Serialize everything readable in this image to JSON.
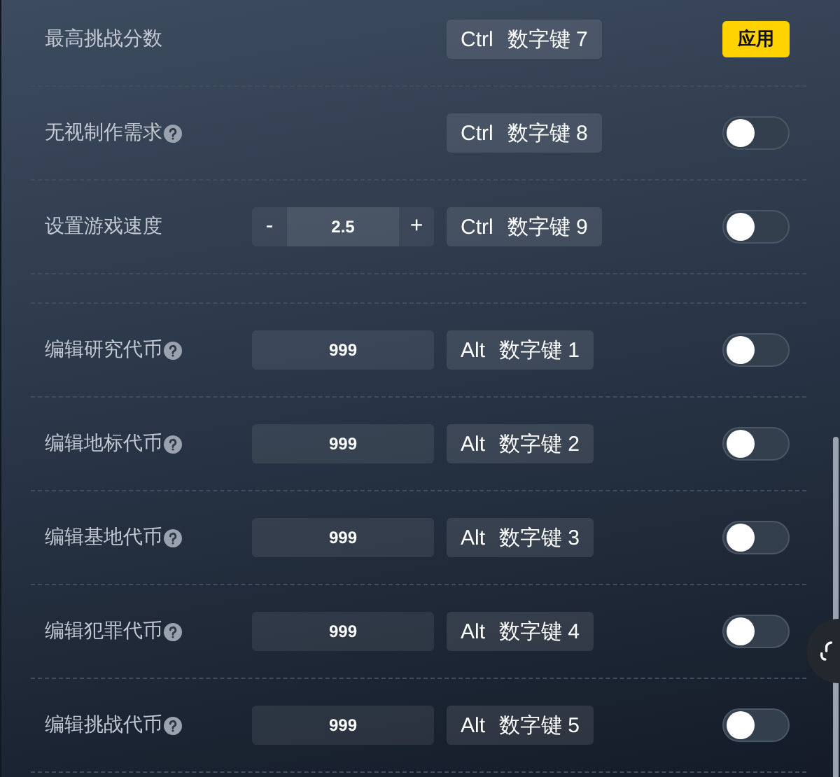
{
  "sections": [
    {
      "rows": [
        {
          "label": "最高挑战分数",
          "help": false,
          "hotkey": {
            "modifier": "Ctrl",
            "key": "数字键 7"
          },
          "action": {
            "kind": "button",
            "label": "应用"
          }
        },
        {
          "label": "无视制作需求",
          "help": true,
          "hotkey": {
            "modifier": "Ctrl",
            "key": "数字键 8"
          },
          "action": {
            "kind": "toggle",
            "on": false
          }
        },
        {
          "label": "设置游戏速度",
          "help": false,
          "input": {
            "kind": "stepper",
            "minus": "-",
            "value": "2.5",
            "plus": "+"
          },
          "hotkey": {
            "modifier": "Ctrl",
            "key": "数字键 9"
          },
          "action": {
            "kind": "toggle",
            "on": false
          }
        }
      ]
    },
    {
      "rows": [
        {
          "label": "编辑研究代币",
          "help": true,
          "input": {
            "kind": "number",
            "value": "999"
          },
          "hotkey": {
            "modifier": "Alt",
            "key": "数字键 1"
          },
          "action": {
            "kind": "toggle",
            "on": false
          }
        },
        {
          "label": "编辑地标代币",
          "help": true,
          "input": {
            "kind": "number",
            "value": "999"
          },
          "hotkey": {
            "modifier": "Alt",
            "key": "数字键 2"
          },
          "action": {
            "kind": "toggle",
            "on": false
          }
        },
        {
          "label": "编辑基地代币",
          "help": true,
          "input": {
            "kind": "number",
            "value": "999"
          },
          "hotkey": {
            "modifier": "Alt",
            "key": "数字键 3"
          },
          "action": {
            "kind": "toggle",
            "on": false
          }
        },
        {
          "label": "编辑犯罪代币",
          "help": true,
          "input": {
            "kind": "number",
            "value": "999"
          },
          "hotkey": {
            "modifier": "Alt",
            "key": "数字键 4"
          },
          "action": {
            "kind": "toggle",
            "on": false
          }
        },
        {
          "label": "编辑挑战代币",
          "help": true,
          "input": {
            "kind": "number",
            "value": "999"
          },
          "hotkey": {
            "modifier": "Alt",
            "key": "数字键 5"
          },
          "action": {
            "kind": "toggle",
            "on": false
          }
        }
      ]
    }
  ]
}
